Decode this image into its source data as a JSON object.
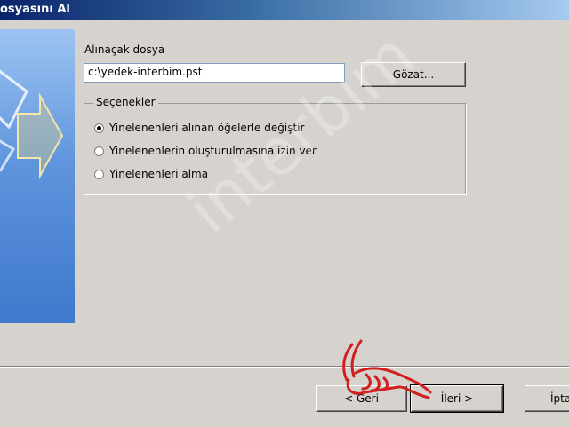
{
  "window": {
    "title": "osyasını Al"
  },
  "file_section": {
    "label": "Alınaçak dosya",
    "value": "c:\\yedek-interbim.pst",
    "browse_label": "Gözat..."
  },
  "options": {
    "caption": "Seçenekler",
    "items": [
      {
        "label": "Yinelenenleri alınan öğelerle değiştir",
        "checked": true
      },
      {
        "label": "Yinelenenlerin oluşturulmasına izin ver",
        "checked": false
      },
      {
        "label": "Yinelenenleri alma",
        "checked": false
      }
    ]
  },
  "footer": {
    "back_label": "< Geri",
    "next_label": "İleri >",
    "cancel_label": "İpta"
  },
  "overlay": {
    "watermark_text": "interbim",
    "pointer_icon": "pointing-hand-icon",
    "pointer_color": "#d21e1e"
  }
}
